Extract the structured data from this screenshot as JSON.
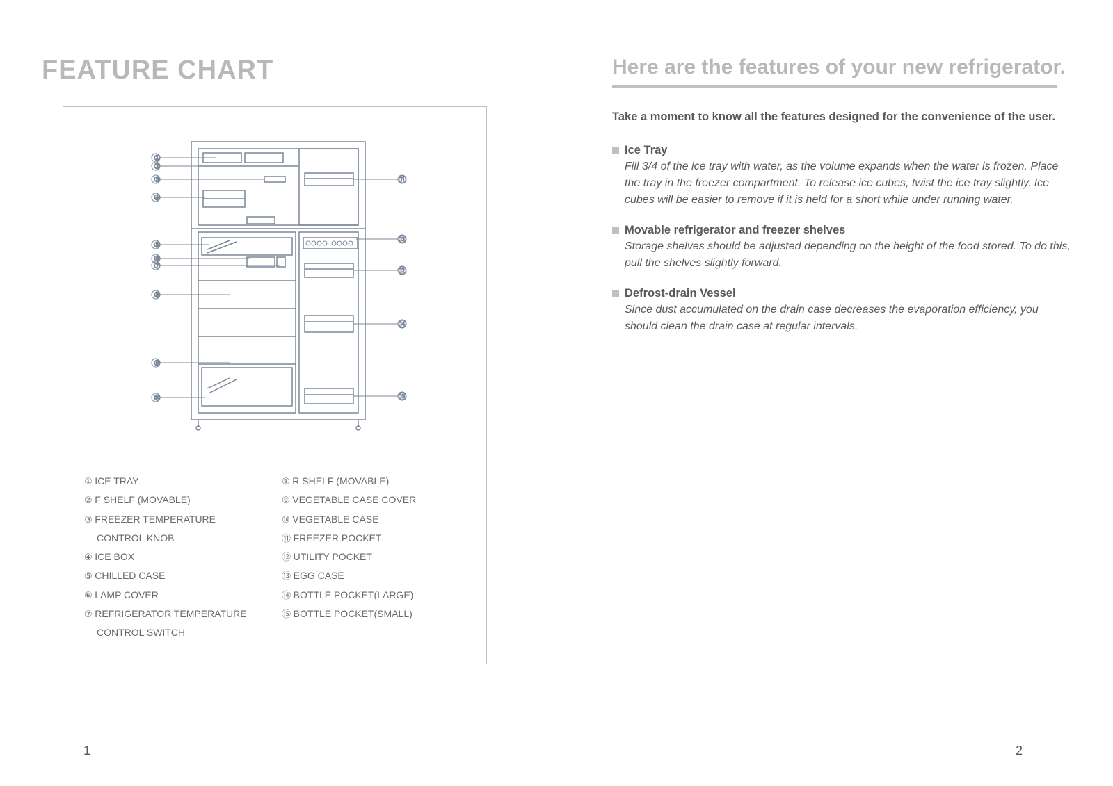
{
  "left": {
    "title": "FEATURE CHART",
    "parts": {
      "col1": [
        {
          "n": "①",
          "t": "ICE TRAY"
        },
        {
          "n": "②",
          "t": "F SHELF (MOVABLE)"
        },
        {
          "n": "③",
          "t": "FREEZER TEMPERATURE"
        },
        {
          "n": "",
          "t": "CONTROL KNOB",
          "indent": true
        },
        {
          "n": "④",
          "t": "ICE BOX"
        },
        {
          "n": "⑤",
          "t": "CHILLED CASE"
        },
        {
          "n": "⑥",
          "t": "LAMP COVER"
        },
        {
          "n": "⑦",
          "t": "REFRIGERATOR TEMPERATURE"
        },
        {
          "n": "",
          "t": "CONTROL SWITCH",
          "indent": true
        }
      ],
      "col2": [
        {
          "n": "⑧",
          "t": "R SHELF (MOVABLE)"
        },
        {
          "n": "⑨",
          "t": "VEGETABLE CASE COVER"
        },
        {
          "n": "⑩",
          "t": "VEGETABLE CASE"
        },
        {
          "n": "⑪",
          "t": "FREEZER POCKET"
        },
        {
          "n": "⑫",
          "t": "UTILITY POCKET"
        },
        {
          "n": "⑬",
          "t": "EGG CASE"
        },
        {
          "n": "⑭",
          "t": "BOTTLE POCKET(LARGE)"
        },
        {
          "n": "⑮",
          "t": "BOTTLE POCKET(SMALL)"
        }
      ]
    },
    "diagram_callouts_left": [
      "①",
      "②",
      "③",
      "④",
      "⑤",
      "⑥",
      "⑦",
      "⑧",
      "⑨",
      "⑩"
    ],
    "diagram_callouts_right": [
      "⑪",
      "⑬",
      "⑫",
      "⑭",
      "⑮"
    ],
    "page_num": "1"
  },
  "right": {
    "title": "Here are the features of your new refrigerator.",
    "intro": "Take a moment to know all the features designed for the convenience of the user.",
    "sections": [
      {
        "title": "Ice Tray",
        "body": "Fill 3/4 of the ice tray with water, as the volume expands when the water is frozen. Place the tray in the freezer compartment. To release ice cubes, twist the ice tray slightly. Ice cubes will be easier to remove if it is held for a short while under running water."
      },
      {
        "title": "Movable refrigerator and freezer shelves",
        "body": "Storage shelves should be adjusted depending on the height of the food stored. To do this, pull the shelves slightly forward."
      },
      {
        "title": "Defrost-drain Vessel",
        "body": "Since dust accumulated on the drain case decreases the evaporation efficiency, you should clean the drain case at regular intervals."
      }
    ],
    "page_num": "2"
  }
}
